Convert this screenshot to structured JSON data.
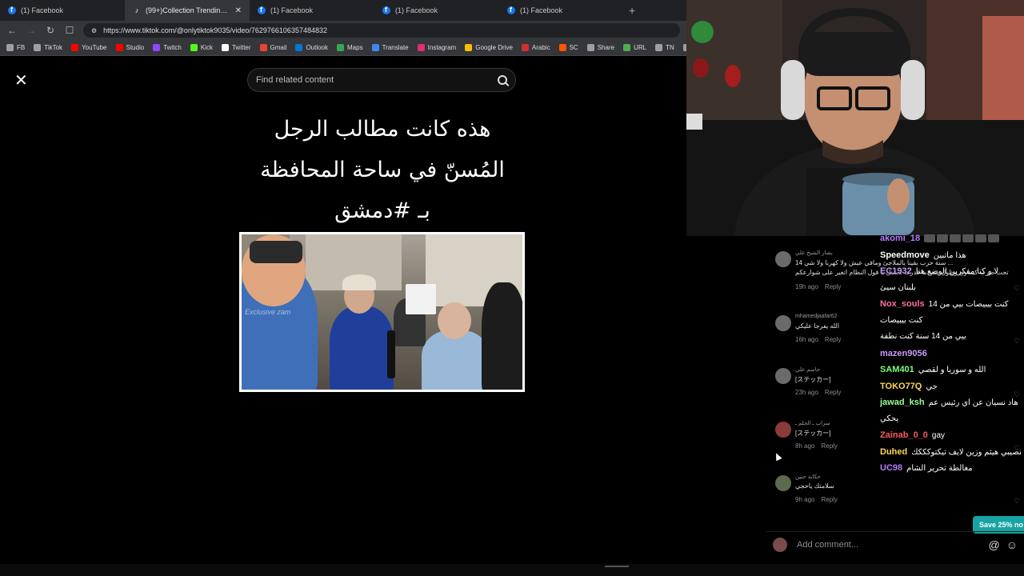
{
  "browser": {
    "tabs": [
      {
        "label": "(1) Facebook",
        "icon": "facebook-icon",
        "active": false
      },
      {
        "label": "(99+)Collection Trending cre",
        "icon": "tiktok-icon",
        "active": true
      },
      {
        "label": "(1) Facebook",
        "icon": "facebook-icon",
        "active": false
      },
      {
        "label": "(1) Facebook",
        "icon": "facebook-icon",
        "active": false
      },
      {
        "label": "(1) Facebook",
        "icon": "facebook-icon",
        "active": false
      }
    ],
    "new_tab": "+",
    "url": "https://www.tiktok.com/@onlytiktok9035/video/7629766106357484832",
    "bookmarks": [
      {
        "label": "FB",
        "color": "#9e9e9e"
      },
      {
        "label": "TikTok",
        "color": "#9e9e9e"
      },
      {
        "label": "YouTube",
        "color": "#ff0000"
      },
      {
        "label": "Studio",
        "color": "#ff0000"
      },
      {
        "label": "Twitch",
        "color": "#9146ff"
      },
      {
        "label": "Kick",
        "color": "#53fc18"
      },
      {
        "label": "Twitter",
        "color": "#ffffff"
      },
      {
        "label": "Gmail",
        "color": "#ea4335"
      },
      {
        "label": "Outlook",
        "color": "#0078d4"
      },
      {
        "label": "Maps",
        "color": "#34a853"
      },
      {
        "label": "Translate",
        "color": "#4285f4"
      },
      {
        "label": "Instagram",
        "color": "#e1306c"
      },
      {
        "label": "Google Drive",
        "color": "#fbbc04"
      },
      {
        "label": "Arabic",
        "color": "#d32f2f"
      },
      {
        "label": "SC",
        "color": "#ff5500"
      },
      {
        "label": "Share",
        "color": "#9e9e9e"
      },
      {
        "label": "URL",
        "color": "#4caf50"
      },
      {
        "label": "TN",
        "color": "#9e9e9e"
      },
      {
        "label": "Ch",
        "color": "#9e9e9e"
      }
    ]
  },
  "tiktok": {
    "search_placeholder": "Find related content",
    "caption_lines": [
      "هذه كانت مطالب الرجل",
      "المُسنّ في ساحة المحافظة",
      "بـ #دمشق"
    ],
    "watermark": "Exclusive zam"
  },
  "comments": [
    {
      "user": "بشار الشيخ علي",
      "text1": "14 سنة حرب بقينا بالملاجئ ومافي عيش ولا كهربا ولا شي ...",
      "text2": "تحت ضرب كيماوي وطول سنه ما قدرت تحتمل يا قول النظام اتغير على شوارعكم",
      "time": "19h ago",
      "reply": "Reply"
    },
    {
      "user": "mhamedjaafar62",
      "text1": "الله يفرجا عليكي",
      "time": "16h ago",
      "reply": "Reply"
    },
    {
      "user": "جاسم علي",
      "text1": "[ステッカー]",
      "time": "23h ago",
      "reply": "Reply"
    },
    {
      "user": "سراب ـ الحلم ـ",
      "text1": "[ステッカー]",
      "time": "8h ago",
      "reply": "Reply"
    },
    {
      "user": "حكاية حنين",
      "text1": "سلامتك ياحجي",
      "time": "9h ago",
      "reply": "Reply"
    }
  ],
  "chat": [
    {
      "user": "akomi_18",
      "color": "#b57cff",
      "msg": ""
    },
    {
      "user": "Speedmove",
      "color": "#ffffff",
      "msg": "هذا ماتبين"
    },
    {
      "user": "EC1932",
      "color": "#c79bff",
      "msg": "لا و كنا مفكرين الوضع هنا"
    },
    {
      "user": "",
      "color": "#ffffff",
      "msg": "بلبنان سيئ"
    },
    {
      "user": "Nox_souls",
      "color": "#ff6fa8",
      "msg": "كنت بيبيصات بيي من 14"
    },
    {
      "user": "",
      "color": "#ffffff",
      "msg": "كنت بيبيصات"
    },
    {
      "user": "",
      "color": "#ffffff",
      "msg": "بيي من 14 سنة كنت نطفة"
    },
    {
      "user": "mazen9056",
      "color": "#c79bff",
      "msg": ""
    },
    {
      "user": "SAM401",
      "color": "#7dff7d",
      "msg": "الله و سوريا و لقصي"
    },
    {
      "user": "TOKO77Q",
      "color": "#ffd75a",
      "msg": "جي"
    },
    {
      "user": "jawad_ksh",
      "color": "#9bff9b",
      "msg": "هاد نسيان عن اي رئيس عم"
    },
    {
      "user": "",
      "color": "#ffffff",
      "msg": "يحكي"
    },
    {
      "user": "Zainab_0_0",
      "color": "#ff5a5a",
      "msg": "gay"
    },
    {
      "user": "Duhed",
      "color": "#ffd75a",
      "msg": "القصيبي هيثم وزين لايف تيكتوكككك"
    },
    {
      "user": "UC98",
      "color": "#b57cff",
      "msg": "مغالطة تحرير الشام"
    }
  ],
  "promo": {
    "label": "Save 25% no"
  },
  "comment_input": {
    "placeholder": "Add comment..."
  }
}
